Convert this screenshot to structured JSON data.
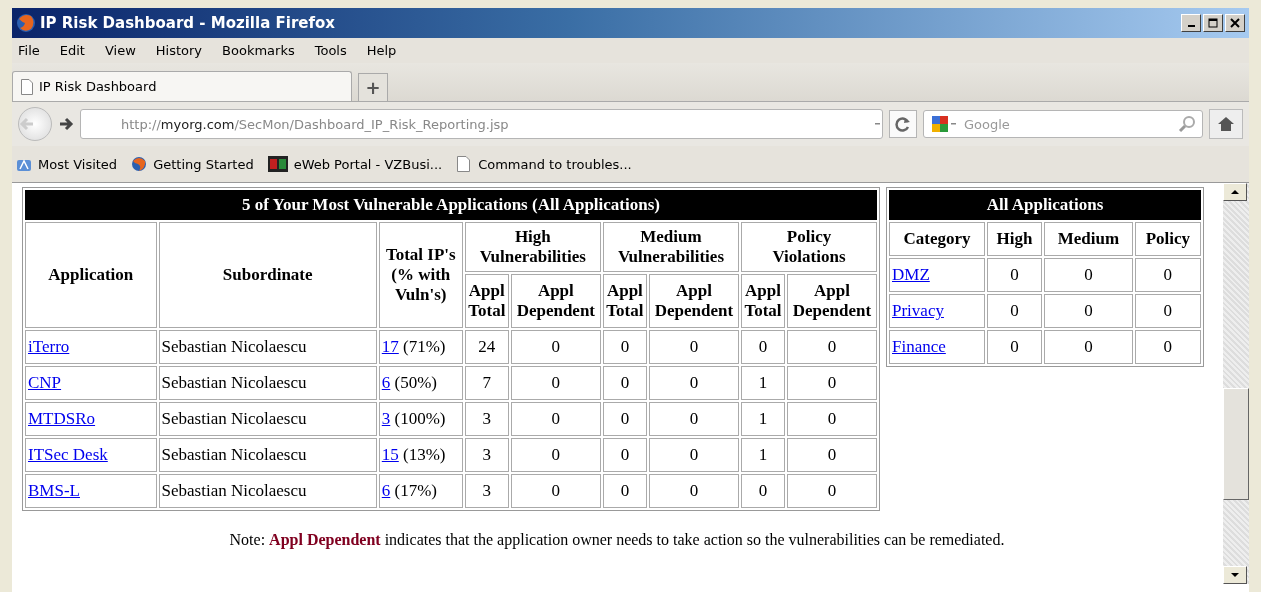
{
  "window": {
    "title": "IP Risk Dashboard - Mozilla Firefox"
  },
  "menu": [
    "File",
    "Edit",
    "View",
    "History",
    "Bookmarks",
    "Tools",
    "Help"
  ],
  "tabs": [
    {
      "label": "IP Risk Dashboard",
      "selected": true
    }
  ],
  "new_tab": "+",
  "address": {
    "url": "http://**myorg.com**/SecMon/Dashboard_IP_Risk_Reporting.jsp"
  },
  "search": {
    "placeholder": "Google"
  },
  "bookmarks": [
    {
      "label": "Most Visited",
      "kind": "folder"
    },
    {
      "label": "Getting Started",
      "kind": "globe"
    },
    {
      "label": "eWeb Portal - VZBusi...",
      "kind": "portal"
    },
    {
      "label": "Command to troubles...",
      "kind": "page"
    }
  ],
  "main_table": {
    "title": "5 of Your Most Vulnerable Applications (All Applications)",
    "columns": [
      "Application",
      "Subordinate",
      "Total IP's (% with Vuln's)"
    ],
    "groups": [
      {
        "label": "High Vulnerabilities",
        "sub": [
          "Appl Total",
          "Appl Dependent"
        ]
      },
      {
        "label": "Medium Vulnerabilities",
        "sub": [
          "Appl Total",
          "Appl Dependent"
        ]
      },
      {
        "label": "Policy Violations",
        "sub": [
          "Appl Total",
          "Appl Dependent"
        ]
      }
    ],
    "rows": [
      {
        "application": "iTerro",
        "subordinate": "Sebastian Nicolaescu",
        "ip_count": "17",
        "ip_percent": "(71%)",
        "values": [
          "24",
          "0",
          "0",
          "0",
          "0",
          "0"
        ]
      },
      {
        "application": "CNP",
        "subordinate": "Sebastian Nicolaescu",
        "ip_count": "6",
        "ip_percent": "(50%)",
        "values": [
          "7",
          "0",
          "0",
          "0",
          "1",
          "0"
        ]
      },
      {
        "application": "MTDSRo",
        "subordinate": "Sebastian Nicolaescu",
        "ip_count": "3",
        "ip_percent": "(100%)",
        "values": [
          "3",
          "0",
          "0",
          "0",
          "1",
          "0"
        ]
      },
      {
        "application": "ITSec Desk",
        "subordinate": "Sebastian Nicolaescu",
        "ip_count": "15",
        "ip_percent": "(13%)",
        "values": [
          "3",
          "0",
          "0",
          "0",
          "1",
          "0"
        ]
      },
      {
        "application": "BMS-L",
        "subordinate": "Sebastian Nicolaescu",
        "ip_count": "6",
        "ip_percent": "(17%)",
        "values": [
          "3",
          "0",
          "0",
          "0",
          "0",
          "0"
        ]
      }
    ]
  },
  "summary_table": {
    "title": "All Applications",
    "columns": [
      "Category",
      "High",
      "Medium",
      "Policy"
    ],
    "rows": [
      {
        "category": "DMZ",
        "values": [
          "0",
          "0",
          "0"
        ]
      },
      {
        "category": "Privacy",
        "values": [
          "0",
          "0",
          "0"
        ]
      },
      {
        "category": "Finance",
        "values": [
          "0",
          "0",
          "0"
        ]
      }
    ]
  },
  "note": "Note: **Appl Dependent** indicates that the application owner needs to take action so the vulnerabilities can be remediated."
}
